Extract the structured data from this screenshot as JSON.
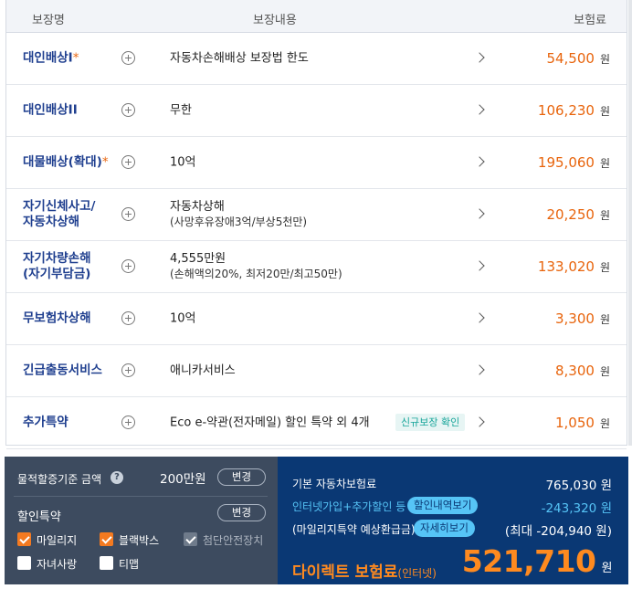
{
  "header": {
    "name": "보장명",
    "content": "보장내용",
    "premium": "보험료"
  },
  "currency": "원",
  "rows": [
    {
      "name": "대인배상I",
      "star": "*",
      "desc": "자동차손해배상 보장법 한도",
      "sub": "",
      "price": "54,500",
      "badge": ""
    },
    {
      "name": "대인배상II",
      "star": "",
      "desc": "무한",
      "sub": "",
      "price": "106,230",
      "badge": ""
    },
    {
      "name": "대물배상(확대)",
      "star": "*",
      "desc": "10억",
      "sub": "",
      "price": "195,060",
      "badge": ""
    },
    {
      "name": "자기신체사고/ 자동차상해",
      "star": "",
      "desc": "자동차상해",
      "sub": "(사망후유장애3억/부상5천만)",
      "price": "20,250",
      "badge": ""
    },
    {
      "name": "자기차량손해 (자기부담금)",
      "star": "",
      "desc": "4,555만원",
      "sub": "(손해액의20%, 최저20만/최고50만)",
      "price": "133,020",
      "badge": ""
    },
    {
      "name": "무보험차상해",
      "star": "",
      "desc": "10억",
      "sub": "",
      "price": "3,300",
      "badge": ""
    },
    {
      "name": "긴급출동서비스",
      "star": "",
      "desc": "애니카서비스",
      "sub": "",
      "price": "8,300",
      "badge": ""
    },
    {
      "name": "추가특약",
      "star": "",
      "desc": "Eco e-약관(전자메일) 할인 특약 외 4개",
      "sub": "",
      "price": "1,050",
      "badge": "신규보장 확인"
    }
  ],
  "left_panel": {
    "property_label": "물적할증기준 금액",
    "property_amount": "200만원",
    "change_label": "변경",
    "discount_label": "할인특약",
    "options": [
      {
        "label": "마일리지",
        "state": "checked"
      },
      {
        "label": "블랙박스",
        "state": "checked"
      },
      {
        "label": "첨단안전장치",
        "state": "disabled"
      },
      {
        "label": "자녀사랑",
        "state": "unchecked"
      },
      {
        "label": "티맵",
        "state": "unchecked"
      }
    ]
  },
  "right_panel": {
    "base_label": "기본 자동차보험료",
    "base_value": "765,030 원",
    "discount_label": "인터넷가입+추가할인 등",
    "discount_btn": "할인내역보기",
    "discount_value": "-243,320 원",
    "mileage_label": "(마일리지특약 예상환급금)",
    "mileage_btn": "자세히보기",
    "mileage_value": "(최대 -204,940 원)",
    "direct_label": "다이렉트 보험료",
    "direct_sub": "(인터넷)",
    "total": "521,710",
    "total_unit": "원"
  }
}
